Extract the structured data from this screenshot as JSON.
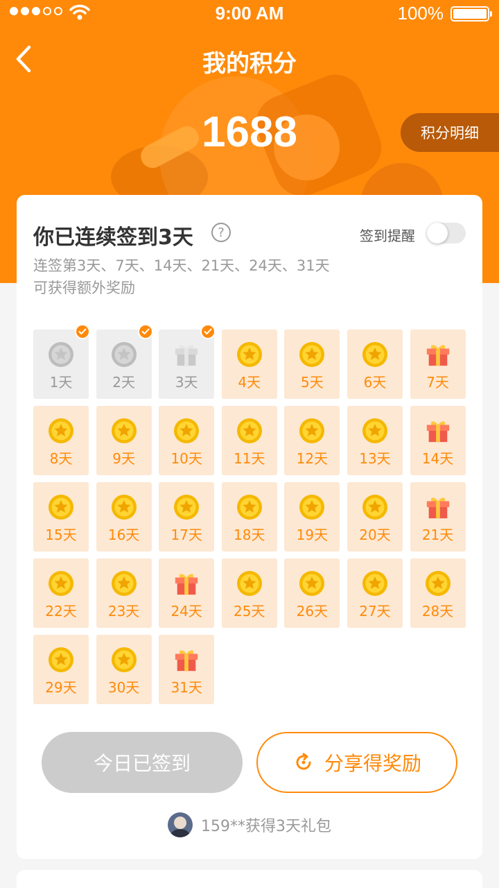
{
  "status_bar": {
    "time": "9:00 AM",
    "battery": "100%"
  },
  "nav": {
    "title": "我的积分"
  },
  "points": {
    "value": "1688",
    "detail_label": "积分明细"
  },
  "checkin": {
    "streak_text": "你已连续签到3天",
    "help_symbol": "?",
    "remind_label": "签到提醒",
    "reminder_on": false,
    "description": "连签第3天、7天、14天、21天、24天、31天可获得额外奖励",
    "days": [
      {
        "label": "1天",
        "reward": "coin",
        "done": true
      },
      {
        "label": "2天",
        "reward": "coin",
        "done": true
      },
      {
        "label": "3天",
        "reward": "gift",
        "done": true
      },
      {
        "label": "4天",
        "reward": "coin",
        "done": false
      },
      {
        "label": "5天",
        "reward": "coin",
        "done": false
      },
      {
        "label": "6天",
        "reward": "coin",
        "done": false
      },
      {
        "label": "7天",
        "reward": "gift",
        "done": false
      },
      {
        "label": "8天",
        "reward": "coin",
        "done": false
      },
      {
        "label": "9天",
        "reward": "coin",
        "done": false
      },
      {
        "label": "10天",
        "reward": "coin",
        "done": false
      },
      {
        "label": "11天",
        "reward": "coin",
        "done": false
      },
      {
        "label": "12天",
        "reward": "coin",
        "done": false
      },
      {
        "label": "13天",
        "reward": "coin",
        "done": false
      },
      {
        "label": "14天",
        "reward": "gift",
        "done": false
      },
      {
        "label": "15天",
        "reward": "coin",
        "done": false
      },
      {
        "label": "16天",
        "reward": "coin",
        "done": false
      },
      {
        "label": "17天",
        "reward": "coin",
        "done": false
      },
      {
        "label": "18天",
        "reward": "coin",
        "done": false
      },
      {
        "label": "19天",
        "reward": "coin",
        "done": false
      },
      {
        "label": "20天",
        "reward": "coin",
        "done": false
      },
      {
        "label": "21天",
        "reward": "gift",
        "done": false
      },
      {
        "label": "22天",
        "reward": "coin",
        "done": false
      },
      {
        "label": "23天",
        "reward": "coin",
        "done": false
      },
      {
        "label": "24天",
        "reward": "gift",
        "done": false
      },
      {
        "label": "25天",
        "reward": "coin",
        "done": false
      },
      {
        "label": "26天",
        "reward": "coin",
        "done": false
      },
      {
        "label": "27天",
        "reward": "coin",
        "done": false
      },
      {
        "label": "28天",
        "reward": "coin",
        "done": false
      },
      {
        "label": "29天",
        "reward": "coin",
        "done": false
      },
      {
        "label": "30天",
        "reward": "coin",
        "done": false
      },
      {
        "label": "31天",
        "reward": "gift",
        "done": false
      }
    ]
  },
  "actions": {
    "signed_label": "今日已签到",
    "share_label": "分享得奖励"
  },
  "ticker": {
    "text": "159**获得3天礼包"
  },
  "colors": {
    "accent": "#ff8a0a",
    "tile": "#fde8d3",
    "tile_done": "#eeeeee",
    "detail_btn": "#b85a08"
  }
}
